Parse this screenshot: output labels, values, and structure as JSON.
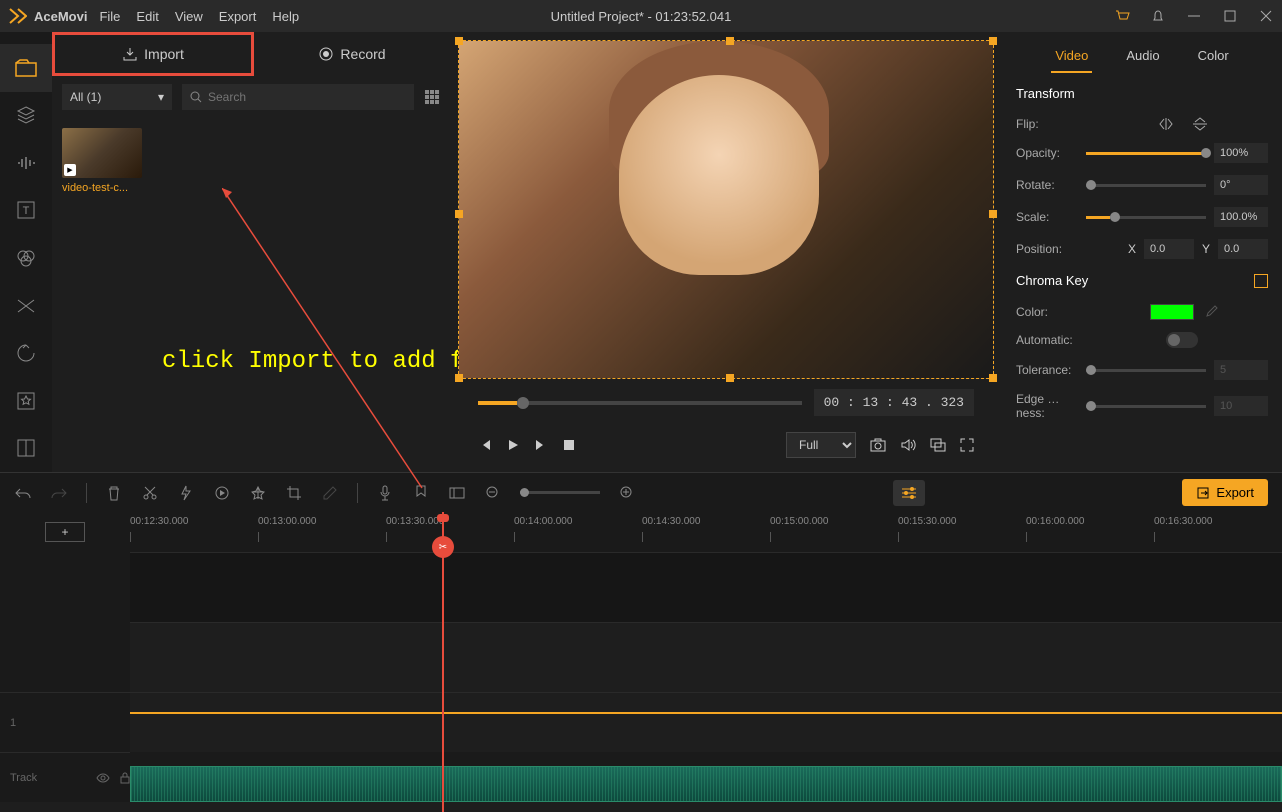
{
  "app": {
    "name": "AceMovi",
    "title": "Untitled Project* - 01:23:52.041"
  },
  "menu": [
    "File",
    "Edit",
    "View",
    "Export",
    "Help"
  ],
  "media": {
    "import_label": "Import",
    "record_label": "Record",
    "filter": "All (1)",
    "search_placeholder": "Search",
    "thumb_name": "video-test-c..."
  },
  "annotation": "click Import to add files",
  "preview": {
    "timecode": "00 : 13 : 43 . 323",
    "zoom": "Full"
  },
  "props": {
    "tabs": [
      "Video",
      "Audio",
      "Color"
    ],
    "transform_header": "Transform",
    "flip_label": "Flip:",
    "opacity_label": "Opacity:",
    "opacity_value": "100%",
    "rotate_label": "Rotate:",
    "rotate_value": "0°",
    "scale_label": "Scale:",
    "scale_value": "100.0%",
    "position_label": "Position:",
    "pos_x_label": "X",
    "pos_x": "0.0",
    "pos_y_label": "Y",
    "pos_y": "0.0",
    "chroma_header": "Chroma Key",
    "color_label": "Color:",
    "automatic_label": "Automatic:",
    "tolerance_label": "Tolerance:",
    "tolerance_value": "5",
    "edge_label": "Edge …ness:",
    "edge_value": "10"
  },
  "toolbar": {
    "export_label": "Export"
  },
  "timeline": {
    "ticks": [
      "00:12:30.000",
      "00:13:00.000",
      "00:13:30.000",
      "00:14:00.000",
      "00:14:30.000",
      "00:15:00.000",
      "00:15:30.000",
      "00:16:00.000",
      "00:16:30.000"
    ],
    "track_num": "1",
    "track_label": "Track"
  }
}
